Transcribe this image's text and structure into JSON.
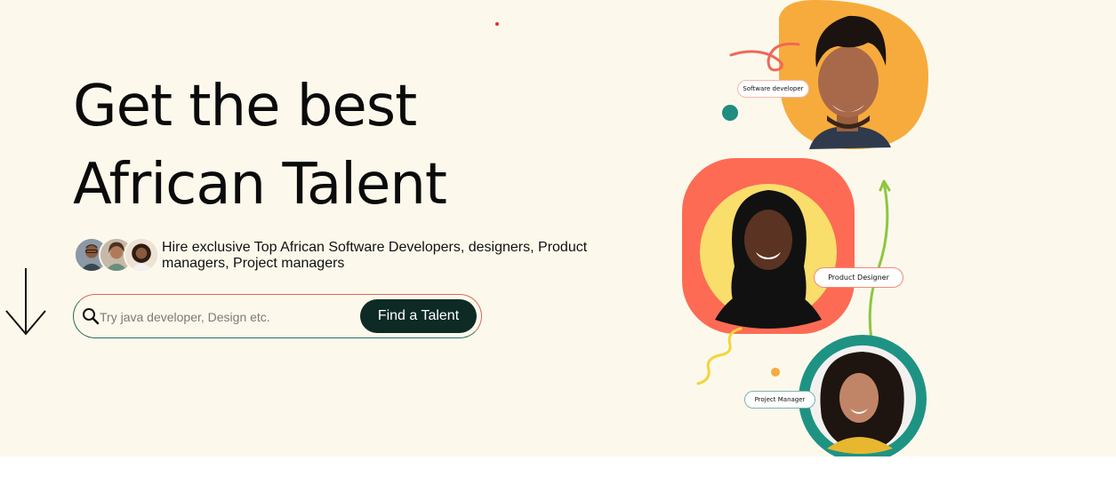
{
  "hero": {
    "headline_line1": "Get the best",
    "headline_line2": "African Talent",
    "subtext": "Hire exclusive Top African Software Developers, designers, Product managers, Project managers"
  },
  "search": {
    "placeholder": "Try java developer, Design etc.",
    "button_label": "Find a Talent",
    "icon": "search-icon"
  },
  "roles": {
    "developer": "Software developer",
    "designer": "Product Designer",
    "manager": "Project Manager"
  },
  "colors": {
    "hero_bg": "#fcf9ec",
    "button_bg": "#0e2a25",
    "orange": "#f7ab3d",
    "coral": "#fd6b55",
    "yellow": "#f9de6c",
    "teal": "#1f9383",
    "green_arrow": "#8dc63f"
  }
}
